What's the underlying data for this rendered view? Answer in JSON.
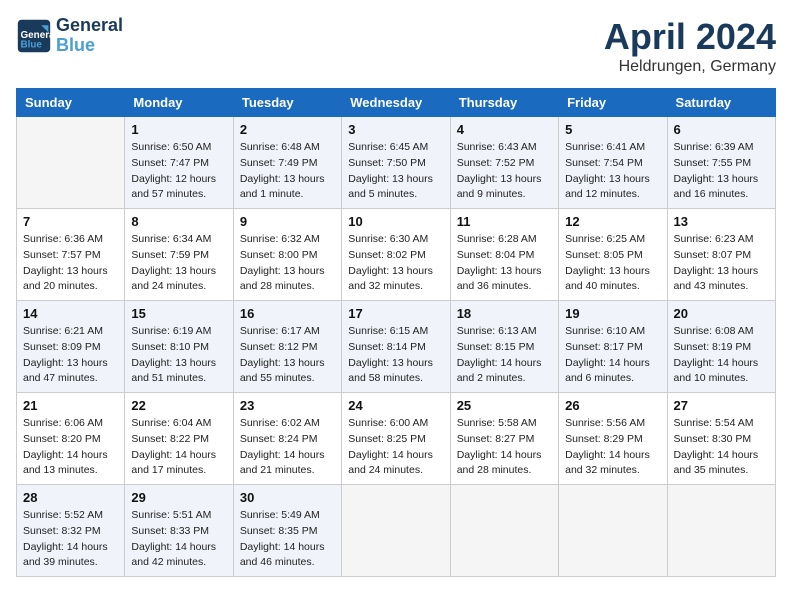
{
  "header": {
    "logo_line1": "General",
    "logo_line2": "Blue",
    "month": "April 2024",
    "location": "Heldrungen, Germany"
  },
  "days_of_week": [
    "Sunday",
    "Monday",
    "Tuesday",
    "Wednesday",
    "Thursday",
    "Friday",
    "Saturday"
  ],
  "weeks": [
    [
      {
        "day": "",
        "detail": ""
      },
      {
        "day": "1",
        "detail": "Sunrise: 6:50 AM\nSunset: 7:47 PM\nDaylight: 12 hours\nand 57 minutes."
      },
      {
        "day": "2",
        "detail": "Sunrise: 6:48 AM\nSunset: 7:49 PM\nDaylight: 13 hours\nand 1 minute."
      },
      {
        "day": "3",
        "detail": "Sunrise: 6:45 AM\nSunset: 7:50 PM\nDaylight: 13 hours\nand 5 minutes."
      },
      {
        "day": "4",
        "detail": "Sunrise: 6:43 AM\nSunset: 7:52 PM\nDaylight: 13 hours\nand 9 minutes."
      },
      {
        "day": "5",
        "detail": "Sunrise: 6:41 AM\nSunset: 7:54 PM\nDaylight: 13 hours\nand 12 minutes."
      },
      {
        "day": "6",
        "detail": "Sunrise: 6:39 AM\nSunset: 7:55 PM\nDaylight: 13 hours\nand 16 minutes."
      }
    ],
    [
      {
        "day": "7",
        "detail": "Sunrise: 6:36 AM\nSunset: 7:57 PM\nDaylight: 13 hours\nand 20 minutes."
      },
      {
        "day": "8",
        "detail": "Sunrise: 6:34 AM\nSunset: 7:59 PM\nDaylight: 13 hours\nand 24 minutes."
      },
      {
        "day": "9",
        "detail": "Sunrise: 6:32 AM\nSunset: 8:00 PM\nDaylight: 13 hours\nand 28 minutes."
      },
      {
        "day": "10",
        "detail": "Sunrise: 6:30 AM\nSunset: 8:02 PM\nDaylight: 13 hours\nand 32 minutes."
      },
      {
        "day": "11",
        "detail": "Sunrise: 6:28 AM\nSunset: 8:04 PM\nDaylight: 13 hours\nand 36 minutes."
      },
      {
        "day": "12",
        "detail": "Sunrise: 6:25 AM\nSunset: 8:05 PM\nDaylight: 13 hours\nand 40 minutes."
      },
      {
        "day": "13",
        "detail": "Sunrise: 6:23 AM\nSunset: 8:07 PM\nDaylight: 13 hours\nand 43 minutes."
      }
    ],
    [
      {
        "day": "14",
        "detail": "Sunrise: 6:21 AM\nSunset: 8:09 PM\nDaylight: 13 hours\nand 47 minutes."
      },
      {
        "day": "15",
        "detail": "Sunrise: 6:19 AM\nSunset: 8:10 PM\nDaylight: 13 hours\nand 51 minutes."
      },
      {
        "day": "16",
        "detail": "Sunrise: 6:17 AM\nSunset: 8:12 PM\nDaylight: 13 hours\nand 55 minutes."
      },
      {
        "day": "17",
        "detail": "Sunrise: 6:15 AM\nSunset: 8:14 PM\nDaylight: 13 hours\nand 58 minutes."
      },
      {
        "day": "18",
        "detail": "Sunrise: 6:13 AM\nSunset: 8:15 PM\nDaylight: 14 hours\nand 2 minutes."
      },
      {
        "day": "19",
        "detail": "Sunrise: 6:10 AM\nSunset: 8:17 PM\nDaylight: 14 hours\nand 6 minutes."
      },
      {
        "day": "20",
        "detail": "Sunrise: 6:08 AM\nSunset: 8:19 PM\nDaylight: 14 hours\nand 10 minutes."
      }
    ],
    [
      {
        "day": "21",
        "detail": "Sunrise: 6:06 AM\nSunset: 8:20 PM\nDaylight: 14 hours\nand 13 minutes."
      },
      {
        "day": "22",
        "detail": "Sunrise: 6:04 AM\nSunset: 8:22 PM\nDaylight: 14 hours\nand 17 minutes."
      },
      {
        "day": "23",
        "detail": "Sunrise: 6:02 AM\nSunset: 8:24 PM\nDaylight: 14 hours\nand 21 minutes."
      },
      {
        "day": "24",
        "detail": "Sunrise: 6:00 AM\nSunset: 8:25 PM\nDaylight: 14 hours\nand 24 minutes."
      },
      {
        "day": "25",
        "detail": "Sunrise: 5:58 AM\nSunset: 8:27 PM\nDaylight: 14 hours\nand 28 minutes."
      },
      {
        "day": "26",
        "detail": "Sunrise: 5:56 AM\nSunset: 8:29 PM\nDaylight: 14 hours\nand 32 minutes."
      },
      {
        "day": "27",
        "detail": "Sunrise: 5:54 AM\nSunset: 8:30 PM\nDaylight: 14 hours\nand 35 minutes."
      }
    ],
    [
      {
        "day": "28",
        "detail": "Sunrise: 5:52 AM\nSunset: 8:32 PM\nDaylight: 14 hours\nand 39 minutes."
      },
      {
        "day": "29",
        "detail": "Sunrise: 5:51 AM\nSunset: 8:33 PM\nDaylight: 14 hours\nand 42 minutes."
      },
      {
        "day": "30",
        "detail": "Sunrise: 5:49 AM\nSunset: 8:35 PM\nDaylight: 14 hours\nand 46 minutes."
      },
      {
        "day": "",
        "detail": ""
      },
      {
        "day": "",
        "detail": ""
      },
      {
        "day": "",
        "detail": ""
      },
      {
        "day": "",
        "detail": ""
      }
    ]
  ]
}
